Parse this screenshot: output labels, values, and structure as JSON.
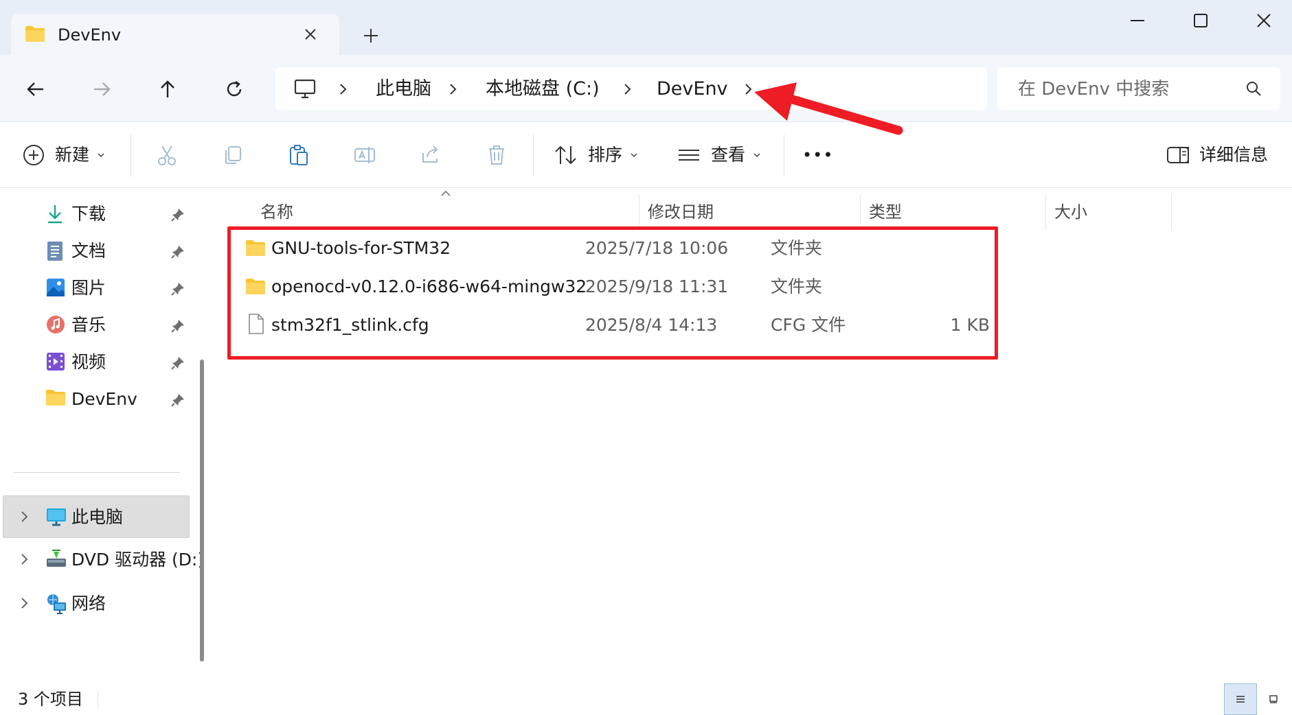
{
  "window": {
    "tab_title": "DevEnv",
    "icons": {
      "tab": "folder-icon",
      "close_tab": "close-icon",
      "new_tab": "plus-icon",
      "minimize": "minimize-icon",
      "maximize": "maximize-icon",
      "close": "close-window-icon"
    }
  },
  "navigation": {
    "buttons": [
      "back-icon",
      "forward-icon",
      "up-icon",
      "refresh-icon"
    ],
    "breadcrumb": [
      "此电脑",
      "本地磁盘 (C:)",
      "DevEnv"
    ],
    "search_placeholder": "在 DevEnv 中搜索"
  },
  "toolbar": {
    "new_label": "新建",
    "sort_label": "排序",
    "view_label": "查看",
    "more_label": "•••",
    "details_label": "详细信息",
    "icons": [
      "cut-icon",
      "copy-icon",
      "paste-icon",
      "rename-icon",
      "share-icon",
      "delete-icon"
    ]
  },
  "sidebar": {
    "quick_access": [
      {
        "label": "下载",
        "icon": "download-icon"
      },
      {
        "label": "文档",
        "icon": "document-icon"
      },
      {
        "label": "图片",
        "icon": "pictures-icon"
      },
      {
        "label": "音乐",
        "icon": "music-icon"
      },
      {
        "label": "视频",
        "icon": "video-icon"
      },
      {
        "label": "DevEnv",
        "icon": "folder-icon"
      }
    ],
    "locations": [
      {
        "label": "此电脑",
        "icon": "computer-icon",
        "selected": true
      },
      {
        "label": "DVD 驱动器 (D:)",
        "icon": "dvd-drive-icon",
        "selected": false
      },
      {
        "label": "网络",
        "icon": "network-icon",
        "selected": false
      }
    ]
  },
  "file_list": {
    "columns": {
      "name": "名称",
      "modified": "修改日期",
      "type": "类型",
      "size": "大小"
    },
    "files": [
      {
        "name": "GNU-tools-for-STM32",
        "modified": "2025/7/18 10:06",
        "type": "文件夹",
        "size": "",
        "icon": "folder-icon"
      },
      {
        "name": "openocd-v0.12.0-i686-w64-mingw32",
        "modified": "2025/9/18 11:31",
        "type": "文件夹",
        "size": "",
        "icon": "folder-icon"
      },
      {
        "name": "stm32f1_stlink.cfg",
        "modified": "2025/8/4 14:13",
        "type": "CFG 文件",
        "size": "1 KB",
        "icon": "file-icon"
      }
    ]
  },
  "status": {
    "item_count": "3 个项目"
  },
  "colors": {
    "annotation_red": "#ee1c24",
    "accent": "#0067c0",
    "titlebar": "#e8eef7",
    "folder": "#f8c536"
  }
}
